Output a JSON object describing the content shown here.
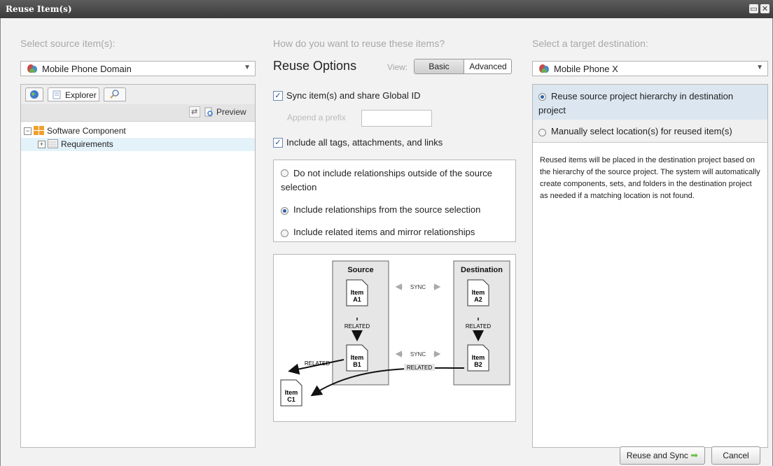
{
  "window": {
    "title": "Reuse Item(s)"
  },
  "source": {
    "heading": "Select source item(s):",
    "selected": "Mobile Phone Domain",
    "tabs": {
      "explorer": "Explorer"
    },
    "toolbar": {
      "preview": "Preview"
    },
    "tree": [
      {
        "label": "Software Component",
        "expander": "−"
      },
      {
        "label": "Requirements",
        "expander": "+"
      }
    ]
  },
  "options": {
    "heading": "How do you want to reuse these items?",
    "title": "Reuse Options",
    "view_label": "View:",
    "view_basic": "Basic",
    "view_advanced": "Advanced",
    "sync_label": "Sync item(s) and share Global ID",
    "prefix_placeholder": "Append a prefix",
    "include_tags_label": "Include all tags, attachments, and links",
    "relationship_options": [
      "Do not include relationships outside of the source selection",
      "Include relationships from the source selection",
      "Include related items and mirror relationships"
    ],
    "selected_relationship_option": "Include relationships from the source selection"
  },
  "diagram": {
    "source_title": "Source",
    "destination_title": "Destination",
    "sync": "SYNC",
    "related": "RELATED",
    "items": {
      "a1": [
        "Item",
        "A1"
      ],
      "b1": [
        "Item",
        "B1"
      ],
      "c1": [
        "Item",
        "C1"
      ],
      "a2": [
        "Item",
        "A2"
      ],
      "b2": [
        "Item",
        "B2"
      ]
    }
  },
  "target": {
    "heading": "Select a target destination:",
    "selected": "Mobile Phone X",
    "option_hierarchy": "Reuse source project hierarchy in destination project",
    "option_manual": "Manually select location(s) for reused item(s)",
    "selected_option": "Reuse source project hierarchy in destination project",
    "description": "Reused items will be placed in the destination project based on the hierarchy of the source project. The system will automatically create components, sets, and folders in the destination project as needed if a matching location is not found."
  },
  "footer": {
    "reuse_button": "Reuse and Sync",
    "cancel_button": "Cancel"
  },
  "colors": {
    "titlebar": "#474747",
    "accent": "#2e5fa8",
    "selected_row": "#e4f2fa",
    "selected_option": "#dce6f0"
  }
}
